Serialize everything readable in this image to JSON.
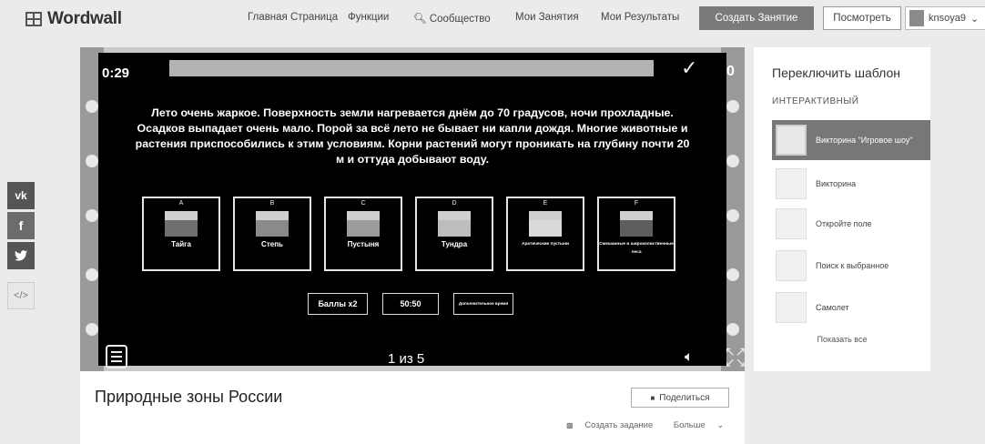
{
  "header": {
    "logo_text": "Wordwall",
    "nav": [
      "Главная Страница",
      "Функции",
      "Сообщество",
      "Мои Занятия",
      "Мои Результаты"
    ],
    "create_label": "Создать Занятие",
    "login_label": "Посмотреть",
    "user_name": "knsoya9"
  },
  "social": {
    "vk": "vk",
    "facebook": "f",
    "twitter": "t",
    "embed": "</>"
  },
  "game": {
    "timer": "0:29",
    "score": "0",
    "question": "Лето очень жаркое. Поверхность земли нагревается днём до 70 градусов, ночи прохладные. Осадков выпадает очень мало. Порой за всё лето не бывает ни капли дождя. Многие животные и растения приспособились к этим условиям. Корни растений могут проникать на глубину почти 20 м и оттуда добывают воду.",
    "options": [
      {
        "letter": "A",
        "label": "Тайга",
        "color": "#6f6f6f"
      },
      {
        "letter": "B",
        "label": "Степь",
        "color": "#8a8a8a"
      },
      {
        "letter": "C",
        "label": "Пустыня",
        "color": "#9c9c9c"
      },
      {
        "letter": "D",
        "label": "Тундра",
        "color": "#bdbdbd"
      },
      {
        "letter": "E",
        "label": "Арктические пустыни",
        "color": "#d9d9d9"
      },
      {
        "letter": "F",
        "label": "Смешанные и широколиственные леса",
        "color": "#5e5e5e"
      }
    ],
    "powerups": [
      "Баллы x2",
      "50:50",
      "Дополнительное время"
    ],
    "page": "1 из 5"
  },
  "title_card": {
    "title": "Природные зоны России",
    "share_label": "Поделиться",
    "create_task": "Создать задание",
    "more": "Больше"
  },
  "panel": {
    "header": "Переключить шаблон",
    "category": "ИНТЕРАКТИВНЫЙ",
    "templates": [
      {
        "name": "Викторина \"Игровое шоу\"",
        "icon": "quiz-show-icon"
      },
      {
        "name": "Викторина",
        "icon": "quiz-icon"
      },
      {
        "name": "Откройте поле",
        "icon": "open-box-icon"
      },
      {
        "name": "Поиск к выбранное",
        "icon": "whack-icon"
      },
      {
        "name": "Самолет",
        "icon": "airplane-icon"
      }
    ],
    "show_all": "Показать все"
  }
}
